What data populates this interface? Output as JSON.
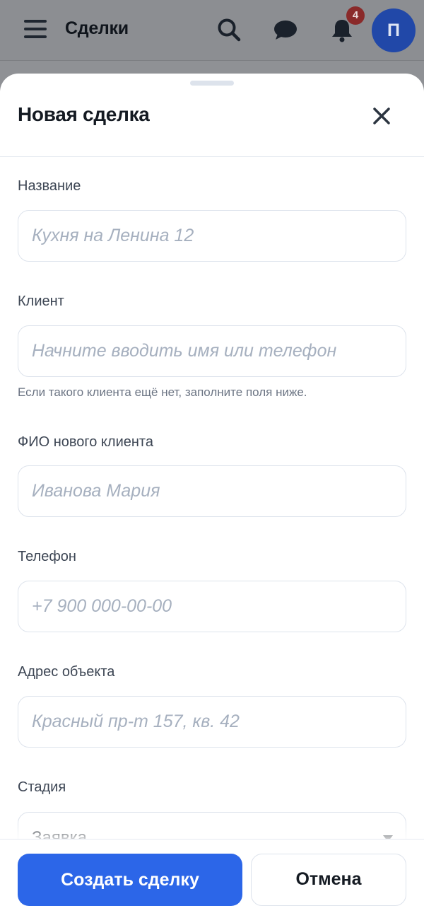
{
  "appbar": {
    "title": "Сделки",
    "notifications_count": "4",
    "avatar_initial": "П",
    "icons": [
      "menu-icon",
      "search-icon",
      "chat-icon",
      "bell-icon"
    ]
  },
  "sheet": {
    "title": "Новая сделка",
    "close_icon": "close-icon"
  },
  "form": {
    "name": {
      "label": "Название",
      "placeholder": "Кухня на Ленина 12",
      "value": ""
    },
    "client": {
      "label": "Клиент",
      "placeholder": "Начните вводить имя или телефон",
      "value": "",
      "hint": "Если такого клиента ещё нет, заполните поля ниже."
    },
    "new_client_name": {
      "label": "ФИО нового клиента",
      "placeholder": "Иванова Мария",
      "value": ""
    },
    "phone": {
      "label": "Телефон",
      "placeholder": "+7 900 000-00-00",
      "value": ""
    },
    "address": {
      "label": "Адрес объекта",
      "placeholder": "Красный пр-т 157, кв. 42",
      "value": ""
    },
    "stage": {
      "label": "Стадия",
      "selected": "Заявка"
    }
  },
  "footer": {
    "create_label": "Создать сделку",
    "cancel_label": "Отмена"
  },
  "colors": {
    "accent": "#2c66e8",
    "badge": "#8a2a2a",
    "avatar": "#2148a8"
  }
}
